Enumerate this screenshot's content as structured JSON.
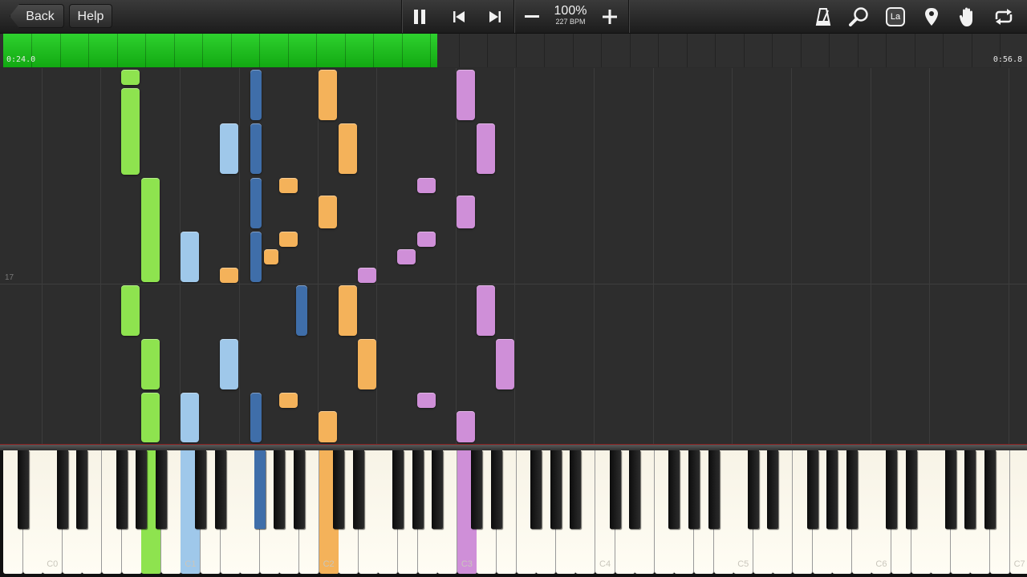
{
  "toolbar": {
    "back_label": "Back",
    "help_label": "Help",
    "speed_percent": "100%",
    "tempo": "227 BPM",
    "icons": [
      "pause-icon",
      "skip-back-icon",
      "skip-forward-icon",
      "minus-icon",
      "plus-icon",
      "metronome-icon",
      "zoom-icon",
      "label-icon",
      "marker-icon",
      "hand-icon",
      "loop-icon"
    ],
    "label_icon_text": "La"
  },
  "progress": {
    "current_time": "0:24.0",
    "total_time": "0:56.8",
    "fraction": 0.424,
    "color": "#1fc21f"
  },
  "measure_label": "17",
  "colors": {
    "green": "#8ee34f",
    "lightblue": "#9fc8ea",
    "darkblue": "#3f6ea9",
    "orange": "#f4b25a",
    "purple": "#cf8fd8"
  },
  "key_labels": [
    "C0",
    "C1",
    "C2",
    "C3",
    "C4",
    "C5",
    "C6",
    "C7"
  ]
}
